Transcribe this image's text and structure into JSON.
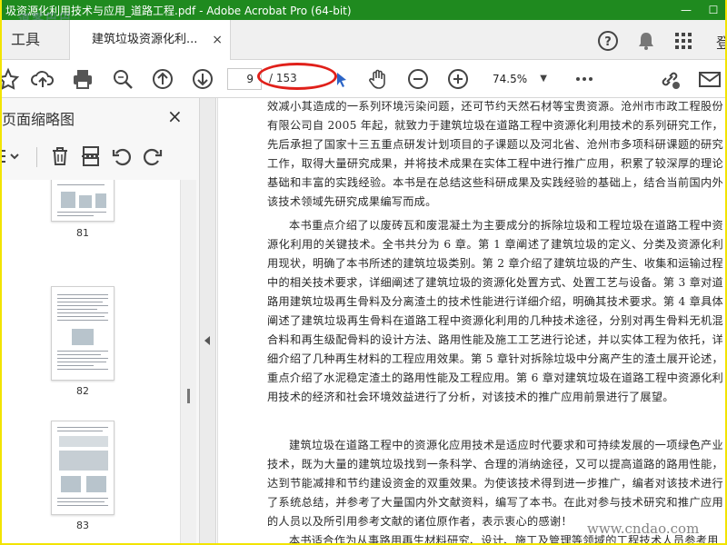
{
  "window": {
    "title": "圾资源化利用技术与应用_道路工程.pdf - Adobe Acrobat Pro (64-bit)",
    "watermark_logo": "道客巴巴",
    "minimize": "—",
    "maximize": "☐"
  },
  "tabs": {
    "tools_label": "工具",
    "doc_tab_label": "建筑垃圾资源化利...",
    "close_glyph": "×",
    "truncated_right": "登"
  },
  "toolbar": {
    "current_page": "9",
    "total_pages": "/ 153",
    "zoom": "74.5%"
  },
  "sidebar": {
    "title": "页面缩略图",
    "close_glyph": "×",
    "thumbnails": [
      {
        "label": "81"
      },
      {
        "label": "82"
      },
      {
        "label": "83"
      }
    ]
  },
  "document": {
    "paragraphs": [
      "效减小其造成的一系列环境污染问题，还可节约天然石材等宝贵资源。沧州市市政工程股份有限公司自 2005 年起，就致力于建筑垃圾在道路工程中资源化利用技术的系列研究工作，先后承担了国家十三五重点研发计划项目的子课题以及河北省、沧州市多项科研课题的研究工作，取得大量研究成果，并将技术成果在实体工程中进行推广应用，积累了较深厚的理论基础和丰富的实践经验。本书是在总结这些科研成果及实践经验的基础上，结合当前国内外该技术领域先研究成果编写而成。",
      "本书重点介绍了以废砖瓦和废混凝土为主要成分的拆除垃圾和工程垃圾在道路工程中资源化利用的关键技术。全书共分为 6 章。第 1 章阐述了建筑垃圾的定义、分类及资源化利用现状，明确了本书所述的建筑垃圾类别。第 2 章介绍了建筑垃圾的产生、收集和运输过程中的相关技术要求，详细阐述了建筑垃圾的资源化处置方式、处置工艺与设备。第 3 章对道路用建筑垃圾再生骨料及分离渣土的技术性能进行详细介绍，明确其技术要求。第 4 章具体阐述了建筑垃圾再生骨料在道路工程中资源化利用的几种技术途径，分别对再生骨料无机混合料和再生级配骨料的设计方法、路用性能及施工工艺进行论述，并以实体工程为依托，详细介绍了几种再生材料的工程应用效果。第 5 章针对拆除垃圾中分离产生的渣土展开论述，重点介绍了水泥稳定渣土的路用性能及工程应用。第 6 章对建筑垃圾在道路工程中资源化利用技术的经济和社会环境效益进行了分析，对该技术的推广应用前景进行了展望。",
      "建筑垃圾在道路工程中的资源化应用技术是适应时代要求和可持续发展的一项绿色产业技术，既为大量的建筑垃圾找到一条科学、合理的消纳途径，又可以提高道路的路用性能，达到节能减排和节约建设资金的双重效果。为使该技术得到进一步推广，编者对该技术进行了系统总结，并参考了大量国内外文献资料，编写了本书。在此对参与技术研究和推广应用的人员以及所引用参考文献的诸位原作者，表示衷心的感谢！",
      "本书适合作为从事路用再生材料研究、设计、施工及管理等领域的工程技术人员参考用"
    ],
    "site_watermark": "www.cndao.com"
  }
}
